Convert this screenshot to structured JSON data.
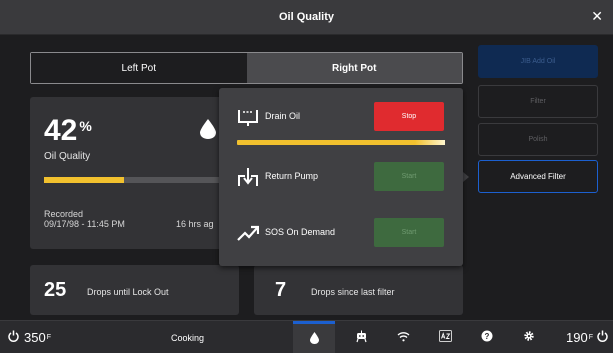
{
  "window": {
    "title": "Oil Quality",
    "close_glyph": "✕"
  },
  "tabs": [
    {
      "label": "Left Pot",
      "selected": false
    },
    {
      "label": "Right Pot",
      "selected": true
    }
  ],
  "quality": {
    "value": "42",
    "unit": "%",
    "label": "Oil Quality",
    "level_percent": 42,
    "recorded_label": "Recorded",
    "recorded_date": "09/17/98 - 11:45 PM",
    "recorded_ago": "16 hrs ag"
  },
  "stats": {
    "drops_until_lockout": {
      "value": "25",
      "label": "Drops until Lock Out"
    },
    "drops_since_filter": {
      "value": "7",
      "label": "Drops since last filter"
    }
  },
  "side_buttons": {
    "jib": "JIB Add Oil",
    "filter": "Filter",
    "polish": "Polish",
    "advanced": "Advanced Filter"
  },
  "popup": {
    "drain": {
      "label": "Drain Oil",
      "button": "Stop",
      "progress_percent": 100
    },
    "return": {
      "label": "Return Pump",
      "button": "Start"
    },
    "sos": {
      "label": "SOS On Demand",
      "button": "Start"
    }
  },
  "bottombar": {
    "left_temp": "350",
    "left_unit": "F",
    "status": "Cooking",
    "right_temp": "190",
    "right_unit": "F"
  },
  "colors": {
    "accent_blue": "#1c60d0",
    "progress_yellow": "#f2c12e",
    "stop_red": "#e02b2f",
    "start_green": "#3e6a3f"
  }
}
